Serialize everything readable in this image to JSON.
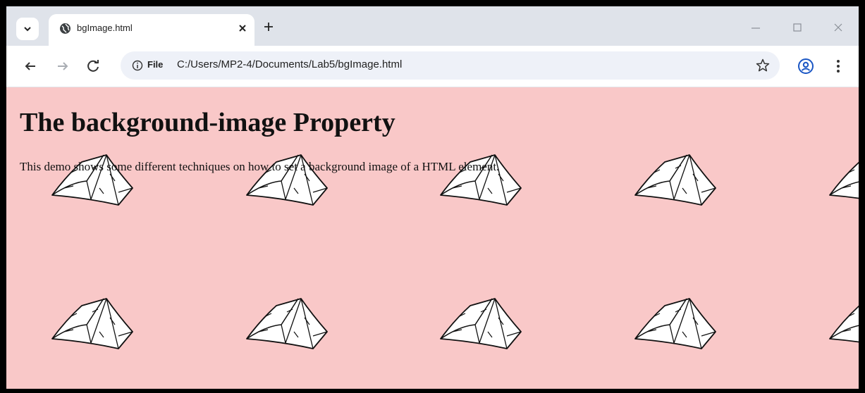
{
  "browser": {
    "tab": {
      "title": "bgImage.html",
      "close_glyph": "✕"
    },
    "new_tab_glyph": "+",
    "address": {
      "chip_label": "File",
      "url": "C:/Users/MP2-4/Documents/Lab5/bgImage.html"
    }
  },
  "page": {
    "heading": "The background-image Property",
    "paragraph": "This demo shows some different techniques on how to set a background image of a HTML element.",
    "background_color": "#f9c8c8"
  },
  "icons": [
    "tab-search-icon",
    "globe-icon",
    "close-icon",
    "plus-icon",
    "minimize-icon",
    "maximize-icon",
    "window-close-icon",
    "back-arrow-icon",
    "forward-arrow-icon",
    "reload-icon",
    "info-icon",
    "star-icon",
    "profile-icon",
    "menu-dots-icon",
    "paper-tile-icon"
  ]
}
